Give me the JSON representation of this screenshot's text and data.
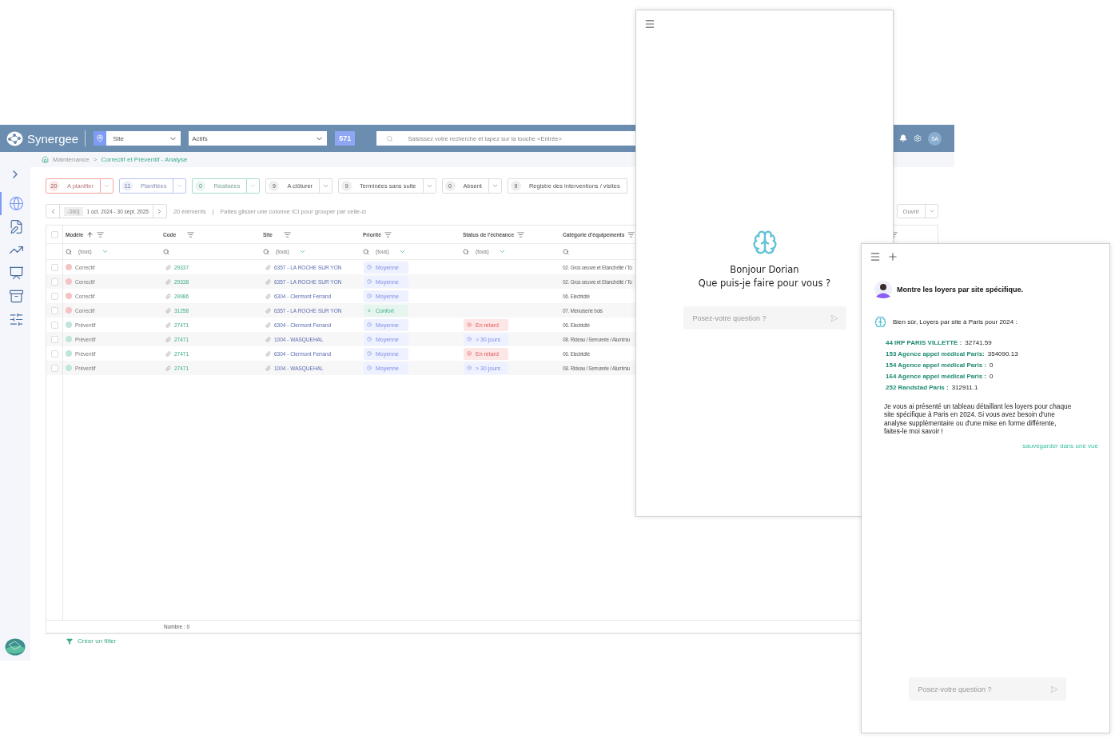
{
  "topbar": {
    "brand": "Synergee",
    "site_select": {
      "value": "Site"
    },
    "status_select": {
      "value": "Actifs"
    },
    "count_badge": "571",
    "search": {
      "placeholder": "Saisissez votre recherche et tapez sur la touche <Entrée>"
    },
    "avatar": "SA"
  },
  "sidebar": {
    "items": [
      {
        "kind": "globe",
        "selected": true
      },
      {
        "kind": "document",
        "selected": false
      },
      {
        "kind": "chart",
        "selected": false
      },
      {
        "kind": "board",
        "selected": false
      },
      {
        "kind": "archive",
        "selected": false
      },
      {
        "kind": "sliders",
        "selected": false
      }
    ]
  },
  "breadcrumb": {
    "separator": ">",
    "items": [
      {
        "label": "Maintenance",
        "current": false
      },
      {
        "label": "Correctif et Préventif - Analyse",
        "current": true
      }
    ]
  },
  "status_tabs": [
    {
      "count": "20",
      "label": "A planifier",
      "color": "#f3a3a3",
      "menu": true
    },
    {
      "count": "11",
      "label": "Planifiées",
      "color": "#b4c3f5",
      "menu": true
    },
    {
      "count": "0",
      "label": "Réalisées",
      "color": "#a6dcc6",
      "menu": true
    },
    {
      "count": "9",
      "label": "A clôturer",
      "color": "#dcdcdc",
      "menu": true
    },
    {
      "count": "9",
      "label": "Terminées sans suite",
      "color": "#dcdcdc",
      "menu": true
    },
    {
      "count": "0",
      "label": "Absent",
      "color": "#dcdcdc",
      "menu": true
    },
    {
      "count": "9",
      "label": "Registre des interventions / visites",
      "color": "#dcdcdc",
      "menu": false
    }
  ],
  "period": {
    "offset": "-360j",
    "range": "1 oct. 2024 - 30 sept. 2025"
  },
  "summary": {
    "count": "20 éléments",
    "separator": "|",
    "hint": "Faites glisser une colonne ICI pour grouper par celle-ci"
  },
  "open_button": {
    "label": "Ouvrir"
  },
  "table": {
    "select_all": {
      "checked": false
    },
    "columns": [
      {
        "label": "Modèle",
        "sorted": true,
        "filter": "(tous)"
      },
      {
        "label": "Code",
        "sorted": false
      },
      {
        "label": "Site",
        "sorted": false,
        "filter": "(tous)"
      },
      {
        "label": "Priorité",
        "sorted": false,
        "filter": "(tous)"
      },
      {
        "label": "Status de l'échéance",
        "sorted": false,
        "filter": "(tous)"
      },
      {
        "label": "Catégorie d'équipements",
        "sorted": false
      }
    ],
    "rows": [
      {
        "checked": false,
        "color": "#f4c4c4",
        "model": "Correctif",
        "code": "29337",
        "site": "6357 - LA ROCHE SUR YON",
        "priority": {
          "kind": "medium",
          "label": "Moyenne"
        },
        "category": "02. Gros oeuvre et Etanchéité / To"
      },
      {
        "checked": false,
        "color": "#f4c4c4",
        "model": "Correctif",
        "code": "29338",
        "site": "6357 - LA ROCHE SUR YON",
        "priority": {
          "kind": "medium",
          "label": "Moyenne"
        },
        "category": "02. Gros oeuvre et Etanchéité / To"
      },
      {
        "checked": false,
        "color": "#f4c4c4",
        "model": "Correctif",
        "code": "29986",
        "site": "6304 - Clermont Ferrand",
        "priority": {
          "kind": "medium",
          "label": "Moyenne"
        },
        "category": "06. Electricité"
      },
      {
        "checked": false,
        "color": "#f4c4c4",
        "model": "Correctif",
        "code": "31258",
        "site": "6357 - LA ROCHE SUR YON",
        "priority": {
          "kind": "low",
          "label": "Confort"
        },
        "category": "07. Menuiserie bois"
      },
      {
        "checked": false,
        "color": "#bfe6dc",
        "model": "Préventif",
        "code": "27471",
        "site": "6304 - Clermont Ferrand",
        "priority": {
          "kind": "medium",
          "label": "Moyenne"
        },
        "status": {
          "kind": "late",
          "label": "En retard"
        },
        "category": "06. Electricité"
      },
      {
        "checked": false,
        "color": "#bfe6dc",
        "model": "Préventif",
        "code": "27471",
        "site": "1004 - WASQUEHAL",
        "priority": {
          "kind": "medium",
          "label": "Moyenne"
        },
        "status": {
          "kind": "later",
          "label": "> 30 jours"
        },
        "category": "08. Rideau / Serrurerie / Aluminiu"
      },
      {
        "checked": false,
        "color": "#bfe6dc",
        "model": "Préventif",
        "code": "27471",
        "site": "6304 - Clermont Ferrand",
        "priority": {
          "kind": "medium",
          "label": "Moyenne"
        },
        "status": {
          "kind": "late",
          "label": "En retard"
        },
        "category": "06. Electricité"
      },
      {
        "checked": false,
        "color": "#bfe6dc",
        "model": "Préventif",
        "code": "27471",
        "site": "1004 - WASQUEHAL",
        "priority": {
          "kind": "medium",
          "label": "Moyenne"
        },
        "status": {
          "kind": "later",
          "label": "> 30 jours"
        },
        "category": "08. Rideau / Serrurerie / Aluminiu"
      }
    ],
    "footer": "Nombre : 0"
  },
  "filter_link": "Créer un filter",
  "chat_home": {
    "greeting": "Bonjour Dorian",
    "prompt": "Que puis-je faire pour vous ?",
    "input": {
      "placeholder": "Posez-votre question ?"
    }
  },
  "chat_thread": {
    "question": "Montre les loyers par site spécifique.",
    "answer_intro": "Bien sûr, Loyers par site à Paris pour 2024 :",
    "results": [
      {
        "label": "44 IRP PARIS VILLETTE :",
        "value": "32741.59"
      },
      {
        "label": "153 Agence appel médical Paris:",
        "value": "354090.13"
      },
      {
        "label": "154 Agence appel médical Paris :",
        "value": "0"
      },
      {
        "label": "164 Agence appel médical Paris :",
        "value": "0"
      },
      {
        "label": "252 Randstad Paris :",
        "value": "312911.1"
      }
    ],
    "answer_outro": "Je vous  ai présenté un tableau détaillant les loyers pour chaque site spécifique à Paris en 2024. Si vous avez besoin d'une analyse supplémentaire ou  d'une mise en forme différente, faites-le moi savoir !",
    "save_link": "sauvegarder dans une vue",
    "input": {
      "placeholder": "Posez-votre question ?"
    }
  }
}
